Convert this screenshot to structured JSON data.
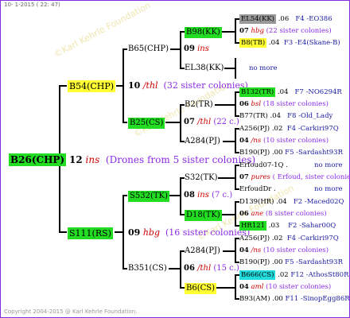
{
  "header": "10-  1-2015 ( 22: 47)",
  "footer": "Copyright 2004-2015 @ Karl Kehrle Foundation.",
  "watermark": "©Karl Kehrle Foundation",
  "root": {
    "name": "B26(CHP)",
    "gen": "12",
    "ins": "ins",
    "drones": "(Drones from 5 sister colonies)"
  },
  "father": {
    "name": "B54(CHP)",
    "gen": "10",
    "ins": "/thl",
    "sisters": "(32 sister colonies)"
  },
  "mother": {
    "name": "S111(RS)",
    "gen": "09",
    "ins": "hbg",
    "sisters": "(16 sister colonies)"
  },
  "ff": {
    "name": "B65(CHP)",
    "gen": "09",
    "ins": "ins"
  },
  "fff": {
    "name": "B98(KK)"
  },
  "ffm": {
    "name": "EL38(KK)",
    "gen": "07",
    "ins": "hbg",
    "sisters": "(22 sister colonies)"
  },
  "fm": {
    "name": "B25(CS)",
    "gen": "07",
    "ins": "/thl",
    "sisters": "(22 c.)"
  },
  "fmf": {
    "name": "B2(TR)"
  },
  "fmm": {
    "name": "A284(PJ)"
  },
  "mf": {
    "name": "S532(TK)",
    "gen": "08",
    "ins": "ins",
    "sisters": "(7 c.)"
  },
  "mff": {
    "name": "S32(TK)"
  },
  "mfm": {
    "name": "D18(TK)"
  },
  "mm": {
    "name": "B351(CS)",
    "gen": "06",
    "ins": "/thl",
    "sisters": "(15 c.)"
  },
  "mmf": {
    "name": "A284(PJ)"
  },
  "mmm": {
    "name": "B6(CS)"
  },
  "rows": [
    {
      "name": "EL54(KK)",
      "gen": ".06",
      "right": "F4 -EO386"
    },
    {
      "gen": "07",
      "ins": "hbg",
      "sisters": "(22 sister colonies)"
    },
    {
      "name": "B8(TB)",
      "gen": ".04",
      "right": "F3 -E4(Skane-B)"
    },
    {
      "nomore": "no more"
    },
    {
      "name": "B132(TR)",
      "gen": ".04",
      "right": "F7 -NO6294R"
    },
    {
      "gen": "06",
      "ins": "bsl",
      "sisters": "(18 sister colonies)"
    },
    {
      "name": "B77(TR)",
      "gen": ".04",
      "right": "F8 -Old_Lady"
    },
    {
      "name": "A256(PJ)",
      "gen": ".02",
      "right": "F4 -Carkiri97Q"
    },
    {
      "gen": "04",
      "ins": "/ns",
      "sisters": "(10 sister colonies)"
    },
    {
      "name": "B190(PJ)",
      "gen": ".00",
      "right": "F5 -Sardasht93R"
    },
    {
      "name": "Erfoud07-1Q",
      "gen": ".",
      "right": "no more"
    },
    {
      "gen": "07",
      "ins": "pures",
      "sisters": "( Erfoud, sister colonies"
    },
    {
      "name": "ErfoudDr",
      "gen": ".",
      "right": "no more"
    },
    {
      "name": "D139(HR)",
      "gen": ".04",
      "right": "F2 -Maced02Q"
    },
    {
      "gen": "06",
      "ins": "ane",
      "sisters": "(8 sister colonies)"
    },
    {
      "name": "HR121",
      "gen": ".03",
      "right": "F2 -Sahar00Q"
    },
    {
      "name": "A256(PJ)",
      "gen": ".02",
      "right": "F4 -Carkiri97Q"
    },
    {
      "gen": "04",
      "ins": "/ns",
      "sisters": "(10 sister colonies)"
    },
    {
      "name": "B190(PJ)",
      "gen": ".00",
      "right": "F5 -Sardasht93R"
    },
    {
      "name": "B666(CS)",
      "gen": ".02",
      "right": "F12 -AthosSt80R"
    },
    {
      "gen": "04",
      "ins": "aml",
      "sisters": "(10 sister colonies)"
    },
    {
      "name": "B93(AM)",
      "gen": ".00",
      "right": "F11 -SinopEgg86R"
    }
  ]
}
